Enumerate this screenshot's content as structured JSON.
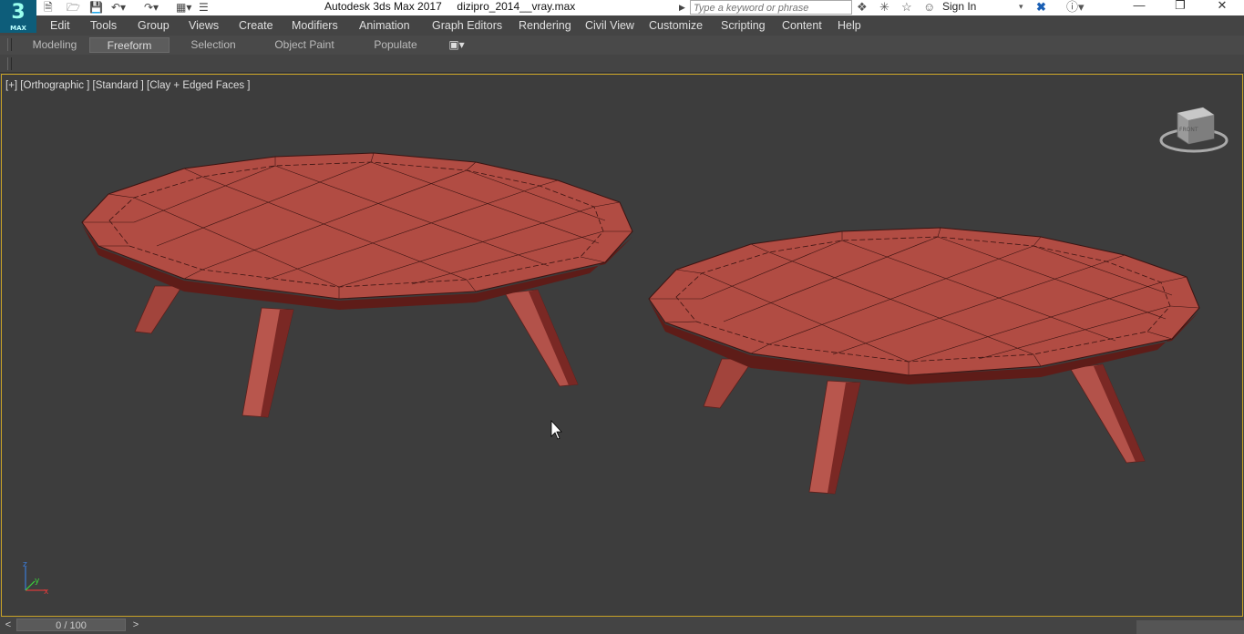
{
  "app": {
    "title": "Autodesk 3ds Max 2017",
    "file": "dizipro_2014__vray.max",
    "logo_number": "3",
    "logo_text": "MAX"
  },
  "search": {
    "placeholder": "Type a keyword or phrase"
  },
  "account": {
    "sign_in": "Sign In"
  },
  "menu": [
    "Edit",
    "Tools",
    "Group",
    "Views",
    "Create",
    "Modifiers",
    "Animation",
    "Graph Editors",
    "Rendering",
    "Civil View",
    "Customize",
    "Scripting",
    "Content",
    "Help"
  ],
  "ribbon_tabs": [
    "Modeling",
    "Freeform",
    "Selection",
    "Object Paint",
    "Populate"
  ],
  "ribbon_active": "Freeform",
  "viewport": {
    "label": "[+] [Orthographic ] [Standard ] [Clay + Edged Faces ]",
    "viewcube_label": "FRONT",
    "axes": [
      "z",
      "y",
      "x"
    ]
  },
  "timeline": {
    "position": "0 / 100",
    "prev": "<",
    "next": ">"
  },
  "colors": {
    "accent": "#c8a227",
    "object": "#b14c43",
    "viewport_bg": "#3d3d3d"
  },
  "icons": [
    "new-file-icon",
    "open-file-icon",
    "save-icon",
    "undo-icon",
    "redo-icon",
    "project-icon",
    "binoculars-icon",
    "pin-icon",
    "star-icon",
    "user-icon",
    "exchange-icon",
    "help-icon",
    "minimize-icon",
    "restore-icon",
    "close-icon"
  ]
}
